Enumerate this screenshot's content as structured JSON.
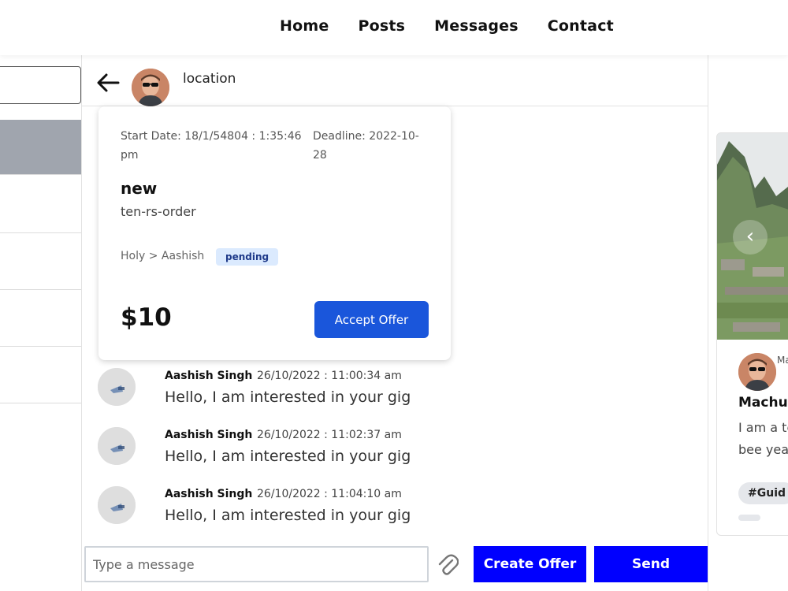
{
  "nav": {
    "links": [
      "Home",
      "Posts",
      "Messages",
      "Contact"
    ]
  },
  "chat": {
    "header": {
      "location": "location"
    },
    "offer": {
      "start_date": "Start Date: 18/1/54804 : 1:35:46 pm",
      "deadline": "Deadline: 2022-10-28",
      "title": "new",
      "subtitle": "ten-rs-order",
      "parties": "Holy > Aashish",
      "status": "pending",
      "price": "$10",
      "accept_label": "Accept Offer"
    },
    "messages": [
      {
        "author": "Aashish Singh",
        "time": "26/10/2022 : 11:00:34 am",
        "text": "Hello, I am interested in your gig"
      },
      {
        "author": "Aashish Singh",
        "time": "26/10/2022 : 11:02:37 am",
        "text": "Hello, I am interested in your gig"
      },
      {
        "author": "Aashish Singh",
        "time": "26/10/2022 : 11:04:10 am",
        "text": "Hello, I am interested in your gig"
      }
    ],
    "composer": {
      "placeholder": "Type a message",
      "create_offer_label": "Create Offer",
      "send_label": "Send"
    }
  },
  "right_panel": {
    "post": {
      "meta": "Ma",
      "title": "Machu",
      "body": "I am a te have bee years an",
      "tag": "#Guid"
    }
  },
  "colors": {
    "primary_button": "#1a56db",
    "composer_button": "#0000ff",
    "badge_bg": "#dbeafe",
    "sidebar_active": "#a0a5ae"
  },
  "icons": [
    "back-arrow-icon",
    "paperclip-icon",
    "chevron-left-icon"
  ]
}
